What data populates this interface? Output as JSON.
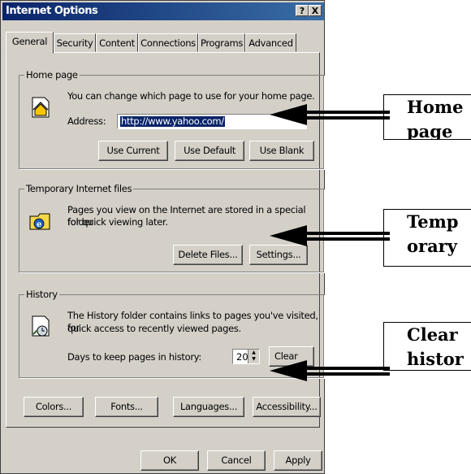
{
  "window": {
    "title": "Internet Options",
    "help_glyph": "?",
    "close_glyph": "X"
  },
  "tabs": [
    "General",
    "Security",
    "Content",
    "Connections",
    "Programs",
    "Advanced"
  ],
  "home_page": {
    "legend": "Home page",
    "description": "You can change which page to use for your home page.",
    "address_label": "Address:",
    "address_value": "http://www.yahoo.com/",
    "buttons": [
      "Use Current",
      "Use Default",
      "Use Blank"
    ]
  },
  "temp_files": {
    "legend": "Temporary Internet files",
    "description_1": "Pages you view on the Internet are stored in a special folder",
    "description_2": "for quick viewing later.",
    "buttons": [
      "Delete Files...",
      "Settings..."
    ]
  },
  "history": {
    "legend": "History",
    "description_1": "The History folder contains links to pages you've visited, for",
    "description_2": "quick access to recently viewed pages.",
    "days_label": "Days to keep pages in history:",
    "days_value": "20",
    "clear_button": "Clear History"
  },
  "bottom_buttons": [
    "Colors...",
    "Fonts...",
    "Languages...",
    "Accessibility..."
  ],
  "footer_buttons": [
    "OK",
    "Cancel",
    "Apply"
  ],
  "annotations": {
    "home_line1": "Home",
    "home_line2": "page",
    "temp_line1": "Temp",
    "temp_line2": "orary",
    "clear_line1": "Clear",
    "clear_line2": "histor"
  },
  "colors": {
    "titlebar": "#0a246a",
    "dialog_face": "#d4d0c8",
    "selection": "#0a246a"
  }
}
